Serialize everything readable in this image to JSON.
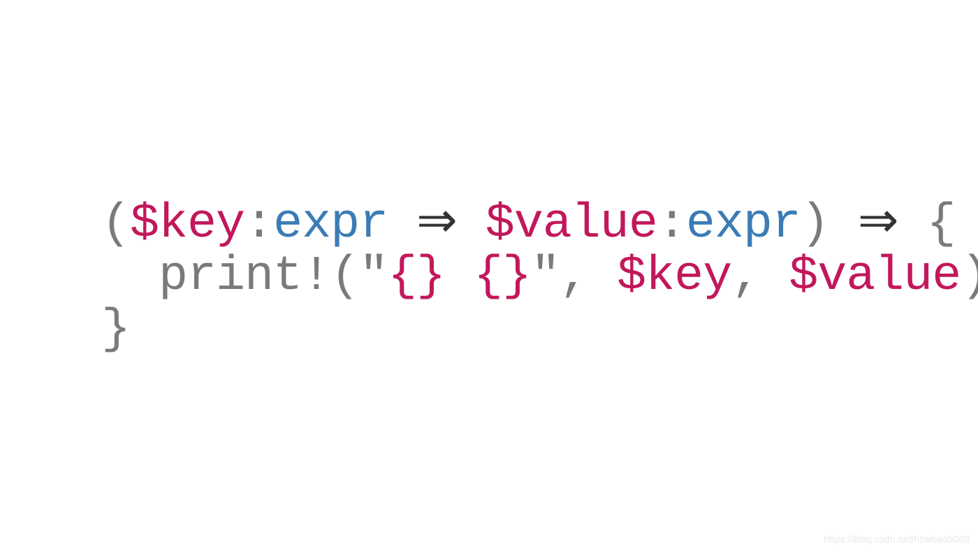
{
  "code": {
    "line1": {
      "paren_open": "(",
      "key_var": "$key",
      "colon1": ":",
      "expr1": "expr",
      "space1": " ",
      "arrow1": "⇒",
      "space2": " ",
      "value_var": "$value",
      "colon2": ":",
      "expr2": "expr",
      "paren_close": ")",
      "space3": " ",
      "arrow2": "⇒",
      "space4": " ",
      "brace_open": "{"
    },
    "line2": {
      "indent": "  ",
      "print_call": "print!(",
      "quote1": "\"",
      "placeholder": "{} {}",
      "quote2": "\"",
      "comma_sp": ", ",
      "key_ref": "$key",
      "comma_sp2": ", ",
      "value_ref": "$value",
      "close": ")"
    },
    "line3": {
      "brace_close": "}"
    }
  },
  "watermark": "https://blog.csdn.net/hzwbao5003"
}
